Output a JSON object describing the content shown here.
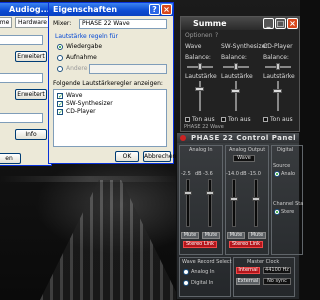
{
  "audio_window": {
    "title": "Audiog...",
    "tabs": [
      "nme",
      "Hardware"
    ],
    "buttons": [
      "Erweitert",
      "Erweitert",
      "Info"
    ],
    "bottom_button": "en"
  },
  "properties_window": {
    "title": "Eigenschaften",
    "mixer_label": "Mixer:",
    "mixer_value": "PHASE 22 Wave",
    "volume_label": "Lautstärke regeln für",
    "options": [
      {
        "label": "Wiedergabe",
        "selected": true
      },
      {
        "label": "Aufnahme",
        "selected": false
      },
      {
        "label": "Andere",
        "selected": false
      }
    ],
    "list_label": "Folgende Lautstärkeregler anzeigen:",
    "channels": [
      "Wave",
      "SW-Synthesizer",
      "CD-Player"
    ],
    "ok": "OK",
    "cancel": "Abbrechen"
  },
  "mixer_window": {
    "title": "Summe",
    "menu": [
      "Optionen",
      "?"
    ],
    "channels": [
      {
        "name": "Wave",
        "mute_label": "Ton aus"
      },
      {
        "name": "SW-Synthesizer",
        "mute_label": "Ton aus"
      },
      {
        "name": "CD-Player",
        "mute_label": "Ton aus"
      }
    ],
    "balance_label": "Balance:",
    "volume_label": "Lautstärke",
    "footer": "PHASE 22 Wave"
  },
  "control_panel": {
    "title": "PHASE 22 Control Panel",
    "analog_in": {
      "label": "Analog In",
      "values": [
        "-2.5",
        "-3.6"
      ],
      "unit": "dB",
      "mute": "Mute",
      "link": "Stereo Link"
    },
    "analog_out": {
      "label": "Analog Output",
      "source": "Wave",
      "values": [
        "-14.0",
        "-15.0"
      ],
      "unit": "dB",
      "mute": "Mute",
      "link": "Stereo Link"
    },
    "digital": {
      "label": "Digital",
      "source_label": "Source",
      "source_option": "Analo",
      "channel_label": "Channel Sta",
      "channel_option": "Stere"
    },
    "wave_record": {
      "label": "Wave Record Select",
      "options": [
        "Analog In",
        "Digital In"
      ]
    },
    "master_clock": {
      "label": "Master Clock",
      "source": "Internal",
      "rate": "44100 Hz",
      "external": "External",
      "sync": "No sync"
    },
    "accent_red": "#b3151b"
  }
}
